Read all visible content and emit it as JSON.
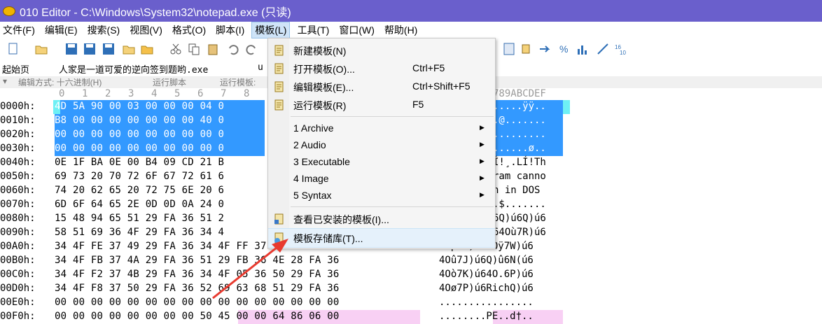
{
  "window": {
    "title": "010 Editor - C:\\Windows\\System32\\notepad.exe (只读)"
  },
  "menubar": [
    {
      "label": "文件(F)"
    },
    {
      "label": "编辑(E)"
    },
    {
      "label": "搜索(S)"
    },
    {
      "label": "视图(V)"
    },
    {
      "label": "格式(O)"
    },
    {
      "label": "脚本(I)"
    },
    {
      "label": "模板(L)"
    },
    {
      "label": "工具(T)"
    },
    {
      "label": "窗口(W)"
    },
    {
      "label": "帮助(H)"
    }
  ],
  "tabs": [
    {
      "label": "起始页"
    },
    {
      "label": "人家是一道可爱的逆向签到题哟.exe"
    },
    {
      "label": "u"
    }
  ],
  "options": {
    "edit_mode": "编辑方式: 十六进制(H)",
    "run_script": "运行脚本",
    "run_template": "运行模板:"
  },
  "hex_header": {
    "cols": [
      "0",
      "1",
      "2",
      "3",
      "4",
      "5",
      "6",
      "7",
      "8"
    ],
    "ascii_header": "789ABCDEF"
  },
  "hex_rows": [
    {
      "addr": "0000h:",
      "bytes": "4D 5A 90 00 03 00 00 00 04 0",
      "ascii": ".....ÿÿ..",
      "sel": true
    },
    {
      "addr": "0010h:",
      "bytes": "B8 00 00 00 00 00 00 00 40 0",
      "ascii": ".@.......",
      "sel": true
    },
    {
      "addr": "0020h:",
      "bytes": "00 00 00 00 00 00 00 00 00 0",
      "ascii": ".........",
      "sel": true
    },
    {
      "addr": "0030h:",
      "bytes": "00 00 00 00 00 00 00 00 00 0",
      "ascii": "......ø..",
      "sel": true
    },
    {
      "addr": "0040h:",
      "bytes": "0E 1F BA 0E 00 B4 09 CD 21 B",
      "ascii": "Í!¸.LÍ!Th",
      "sel": false
    },
    {
      "addr": "0050h:",
      "bytes": "69 73 20 70 72 6F 67 72 61 6",
      "ascii": "ram canno",
      "sel": false
    },
    {
      "addr": "0060h:",
      "bytes": "74 20 62 65 20 72 75 6E 20 6",
      "ascii": "n in DOS",
      "sel": false
    },
    {
      "addr": "0070h:",
      "bytes": "6D 6F 64 65 2E 0D 0D 0A 24 0",
      "ascii": ".$.......",
      "sel": false
    },
    {
      "addr": "0080h:",
      "bytes": "15 48 94 65 51 29 FA 36 51 2",
      "ascii": "6Q)ú6Q)ú6",
      "sel": false
    },
    {
      "addr": "0090h:",
      "bytes": "58 51 69 36 4F 29 FA 36 34 4",
      "ascii": "64Où7R)ú6",
      "sel": false
    },
    {
      "addr": "00A0h:",
      "bytes": "34 4F FE 37 49 29 FA 36 34 4F FF 37 57 29 FA 36",
      "ascii": "4Op7I)ú64Oÿ7W)ú6",
      "sel": false
    },
    {
      "addr": "00B0h:",
      "bytes": "34 4F FB 37 4A 29 FA 36 51 29 FB 36 4E 28 FA 36",
      "ascii": "4Oû7J)ú6Q)û6N(ú6",
      "sel": false
    },
    {
      "addr": "00C0h:",
      "bytes": "34 4F F2 37 4B 29 FA 36 34 4F 05 36 50 29 FA 36",
      "ascii": "4Oò7K)ú64O.6P)ú6",
      "sel": false
    },
    {
      "addr": "00D0h:",
      "bytes": "34 4F F8 37 50 29 FA 36 52 69 63 68 51 29 FA 36",
      "ascii": "4Oø7P)ú6RichQ)ú6",
      "sel": false
    },
    {
      "addr": "00E0h:",
      "bytes": "00 00 00 00 00 00 00 00 00 00 00 00 00 00 00 00",
      "ascii": "................",
      "sel": false
    },
    {
      "addr": "00F0h:",
      "bytes": "00 00 00 00 00 00 00 00 50 45 00 00 64 86 06 00",
      "ascii": "........PE..d†..",
      "sel": false
    }
  ],
  "dropdown": {
    "items": [
      {
        "label": "新建模板(N)",
        "shortcut": ""
      },
      {
        "label": "打开模板(O)...",
        "shortcut": "Ctrl+F5"
      },
      {
        "label": "编辑模板(E)...",
        "shortcut": "Ctrl+Shift+F5"
      },
      {
        "label": "运行模板(R)",
        "shortcut": "F5"
      },
      {
        "label": "1 Archive",
        "shortcut": ""
      },
      {
        "label": "2 Audio",
        "shortcut": ""
      },
      {
        "label": "3 Executable",
        "shortcut": ""
      },
      {
        "label": "4 Image",
        "shortcut": ""
      },
      {
        "label": "5 Syntax",
        "shortcut": ""
      },
      {
        "label": "查看已安装的模板(I)...",
        "shortcut": ""
      },
      {
        "label": "模板存储库(T)...",
        "shortcut": ""
      }
    ]
  },
  "colors": {
    "titlebar": "#6a5fcc",
    "selection": "#3399ff",
    "menu_active": "#cfe4f8",
    "arrow": "#e83a2f"
  }
}
